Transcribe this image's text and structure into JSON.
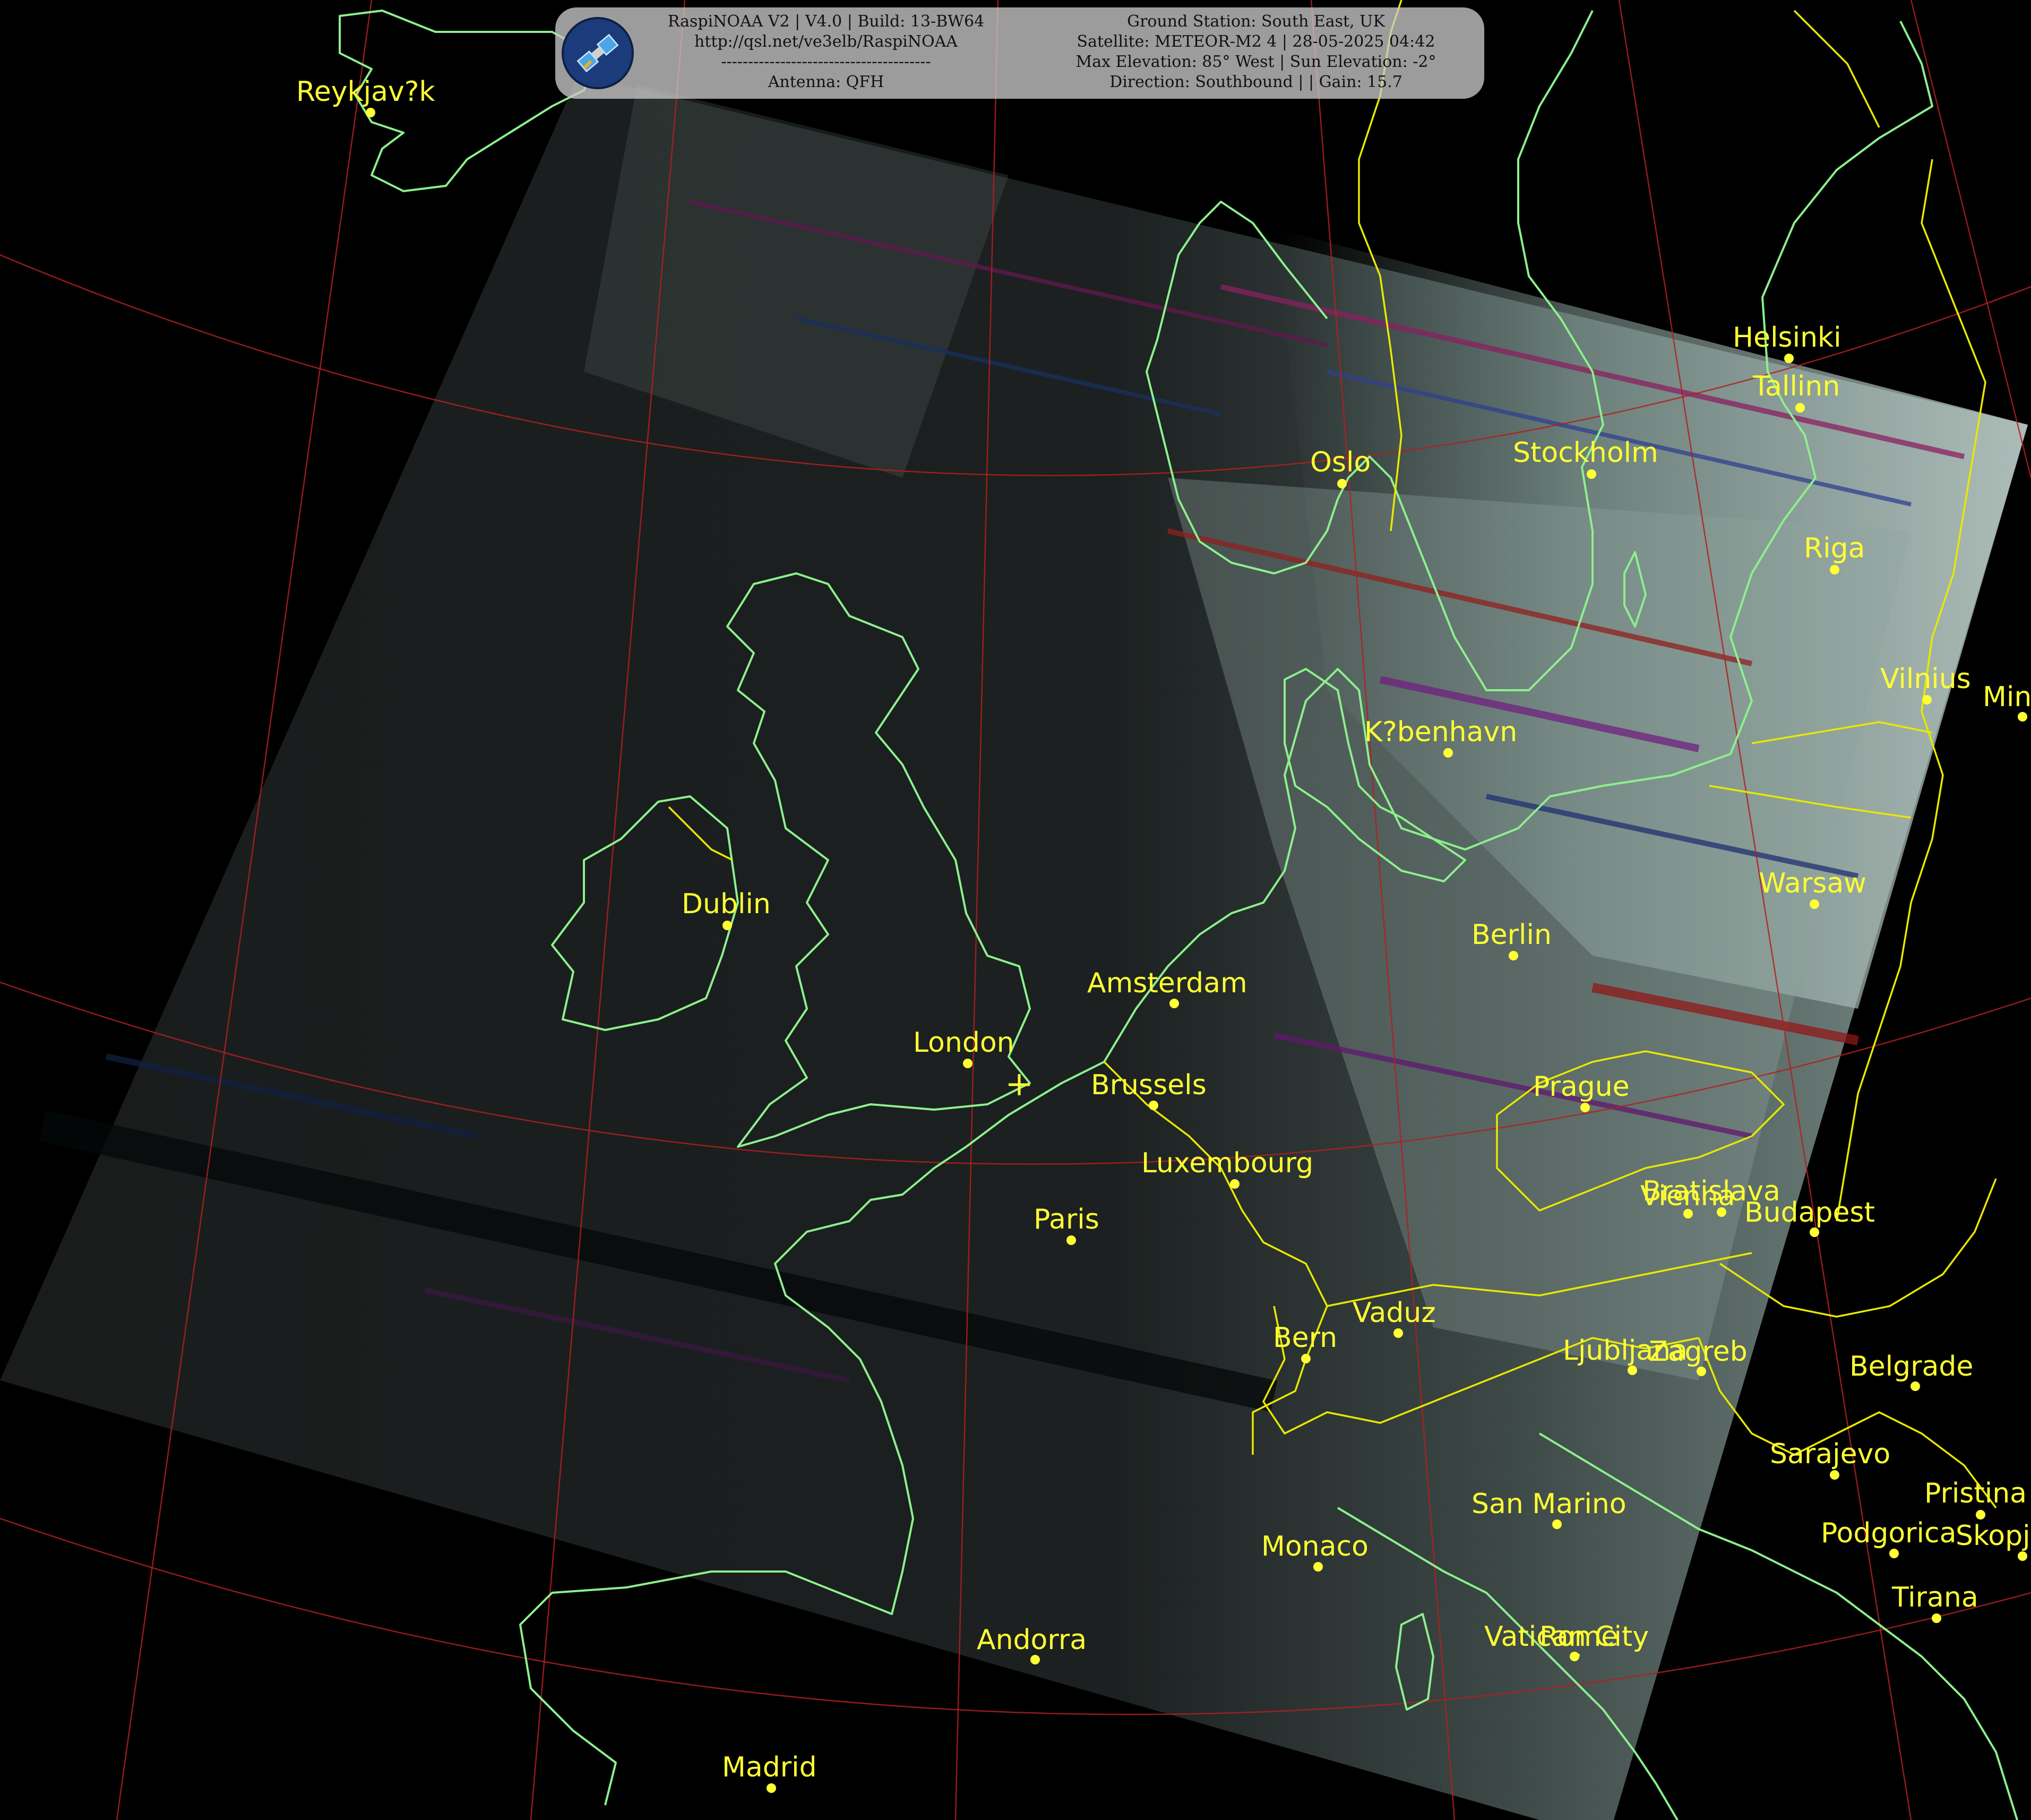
{
  "info": {
    "left_lines": [
      "RaspiNOAA V2 | V4.0 | Build: 13-BW64",
      "http://qsl.net/ve3elb/RaspiNOAA",
      "---------------------------------------",
      "Antenna: QFH"
    ],
    "right_lines": [
      "Ground Station: South East, UK",
      "Satellite: METEOR-M2 4 | 28-05-2025 04:42",
      "Max Elevation: 85° West | Sun Elevation: -2°",
      "Direction: Southbound | | Gain: 15.7"
    ]
  },
  "cities": [
    {
      "name": "Reykjav?k"
    },
    {
      "name": "Helsinki"
    },
    {
      "name": "Tallinn"
    },
    {
      "name": "Oslo"
    },
    {
      "name": "Stockholm"
    },
    {
      "name": "Riga"
    },
    {
      "name": "Vilnius"
    },
    {
      "name": "Min"
    },
    {
      "name": "K?benhavn"
    },
    {
      "name": "Dublin"
    },
    {
      "name": "Warsaw"
    },
    {
      "name": "Berlin"
    },
    {
      "name": "Amsterdam"
    },
    {
      "name": "London"
    },
    {
      "name": "Brussels"
    },
    {
      "name": "Prague"
    },
    {
      "name": "Luxembourg"
    },
    {
      "name": "Paris"
    },
    {
      "name": "Bratislava"
    },
    {
      "name": "Vienna"
    },
    {
      "name": "Budapest"
    },
    {
      "name": "Vaduz"
    },
    {
      "name": "Bern"
    },
    {
      "name": "Ljubljana"
    },
    {
      "name": "Zagreb"
    },
    {
      "name": "Belgrade"
    },
    {
      "name": "Sarajevo"
    },
    {
      "name": "Pristina"
    },
    {
      "name": "San Marino"
    },
    {
      "name": "Monaco"
    },
    {
      "name": "Podgorica"
    },
    {
      "name": "Skopje"
    },
    {
      "name": "Tirana"
    },
    {
      "name": "Andorra"
    },
    {
      "name": "Vatican City"
    },
    {
      "name": "Rome"
    },
    {
      "name": "Madrid"
    }
  ],
  "colors": {
    "coastline": "#8cf08c",
    "borders": "#e8e800",
    "labels": "#ffff33",
    "graticule": "#b02020"
  }
}
